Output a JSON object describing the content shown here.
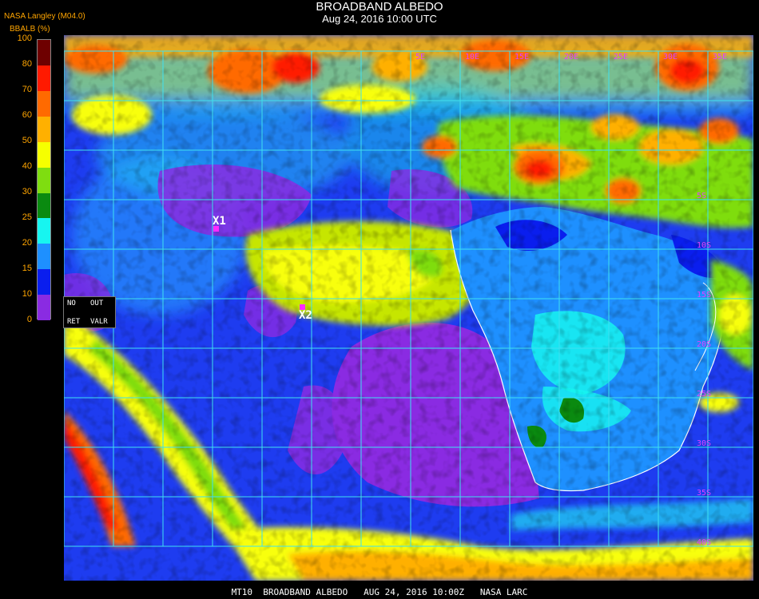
{
  "header": {
    "title": "BROADBAND ALBEDO",
    "subtitle": "Aug 24, 2016 10:00 UTC",
    "source": "NASA Langley (M04.0)"
  },
  "legend": {
    "title": "BBALB (%)",
    "ticks": [
      "100",
      "80",
      "70",
      "60",
      "50",
      "40",
      "30",
      "25",
      "20",
      "15",
      "10",
      "0"
    ],
    "color_steps": [
      {
        "range": "80-100",
        "color": "#6e0000"
      },
      {
        "range": "70-80",
        "color": "#ff1a00"
      },
      {
        "range": "60-70",
        "color": "#ff6a00"
      },
      {
        "range": "50-60",
        "color": "#ffb000"
      },
      {
        "range": "40-50",
        "color": "#f6ff00"
      },
      {
        "range": "30-40",
        "color": "#7fdd10"
      },
      {
        "range": "25-30",
        "color": "#0a8a10"
      },
      {
        "range": "20-25",
        "color": "#17f5f0"
      },
      {
        "range": "15-20",
        "color": "#1e90ff"
      },
      {
        "range": "10-15",
        "color": "#0a1eee"
      },
      {
        "range": "0-10",
        "color": "#8a2be2"
      }
    ]
  },
  "mode_panel": {
    "no_label": "NO",
    "out_label": "OUT",
    "ret_label": "RET",
    "valr_label": "VALR"
  },
  "markers": [
    {
      "label": "X1",
      "color": "#ff2aff"
    },
    {
      "label": "X2",
      "color": "#ff2aff"
    }
  ],
  "grid": {
    "color": "#3fe0f0",
    "lat_labels": [
      "5S",
      "10S",
      "15S",
      "20S",
      "25S",
      "30S",
      "35S",
      "40S"
    ],
    "lon_labels": [
      "5E",
      "10E",
      "15E",
      "20E",
      "25E",
      "30E",
      "35E"
    ]
  },
  "footer": {
    "text": "MT10  BROADBAND ALBEDO   AUG 24, 2016 10:00Z   NASA LARC"
  }
}
